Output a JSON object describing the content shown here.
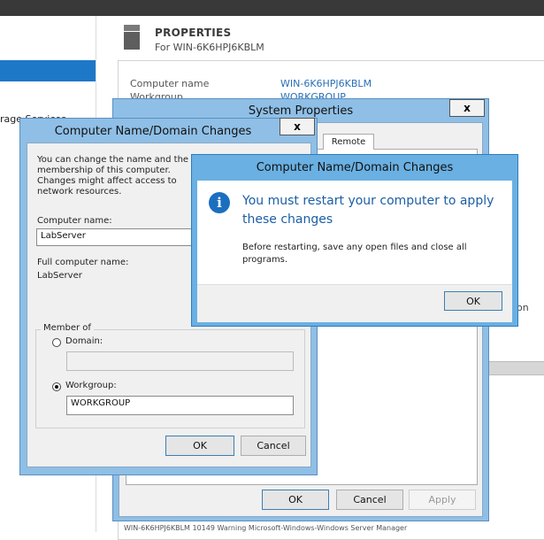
{
  "background": {
    "left_fragment": "rage Services",
    "properties_title": "PROPERTIES",
    "properties_subtitle": "For WIN-6K6HPJ6KBLM",
    "computer_name_label": "Computer name",
    "computer_name_value": "WIN-6K6HPJ6KBLM",
    "workgroup_label_partial": "Workgroup",
    "workgroup_value_partial": "WORKGROUP",
    "right_edge_text": "on",
    "status_fragment": "WIN-6K6HPJ6KBLM  10149  Warning  Microsoft-Windows-Windows Server Manager"
  },
  "system_properties": {
    "title": "System Properties",
    "close_label": "x",
    "tab_remote": "Remote",
    "ok_label": "OK",
    "cancel_label": "Cancel",
    "apply_label": "Apply"
  },
  "name_domain_dialog": {
    "title": "Computer Name/Domain Changes",
    "close_label": "x",
    "description": "You can change the name and the membership of this computer. Changes might affect access to network resources.",
    "computer_name_label": "Computer name:",
    "computer_name_value": "LabServer",
    "full_name_label": "Full computer name:",
    "full_name_value": "LabServer",
    "member_of_label": "Member of",
    "domain_label": "Domain:",
    "domain_value": "",
    "workgroup_label": "Workgroup:",
    "workgroup_value": "WORKGROUP",
    "ok_label": "OK",
    "cancel_label": "Cancel"
  },
  "alert": {
    "title": "Computer Name/Domain Changes",
    "main_message": "You must restart your computer to apply these changes",
    "sub_message": "Before restarting, save any open files and close all programs.",
    "ok_label": "OK",
    "icon": "info-icon"
  },
  "colors": {
    "title_bar_inactive": "#8fbfe6",
    "title_bar_active": "#6ab0e2",
    "link_blue": "#2a6fb5",
    "alert_text_blue": "#1c5ea5",
    "selection_blue": "#1e78c8"
  }
}
